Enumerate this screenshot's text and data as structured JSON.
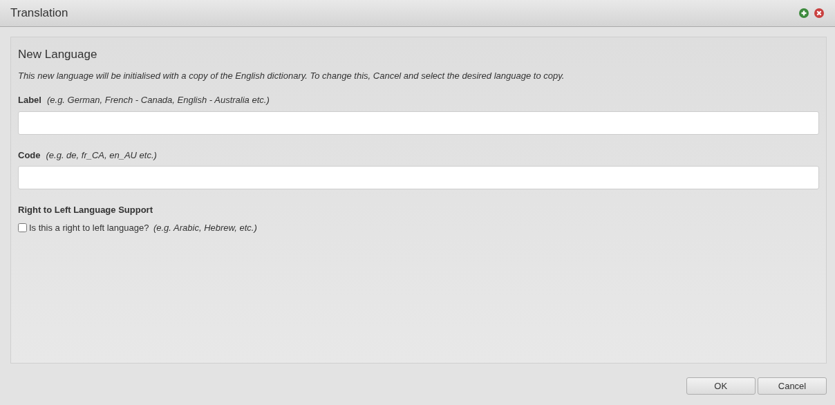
{
  "window": {
    "title": "Translation"
  },
  "panel": {
    "title": "New Language",
    "description": "This new language will be initialised with a copy of the English dictionary. To change this, Cancel and select the desired language to copy.",
    "fields": [
      {
        "label": "Label",
        "hint": "(e.g. German, French - Canada, English - Australia etc.)"
      },
      {
        "label": "Code",
        "hint": "(e.g. de, fr_CA, en_AU etc.)"
      }
    ],
    "rtl": {
      "heading": "Right to Left Language Support",
      "label": "Is this a right to left language?",
      "hint": "(e.g. Arabic, Hebrew, etc.)",
      "checked": false
    }
  },
  "buttons": [
    "OK",
    "Cancel"
  ]
}
